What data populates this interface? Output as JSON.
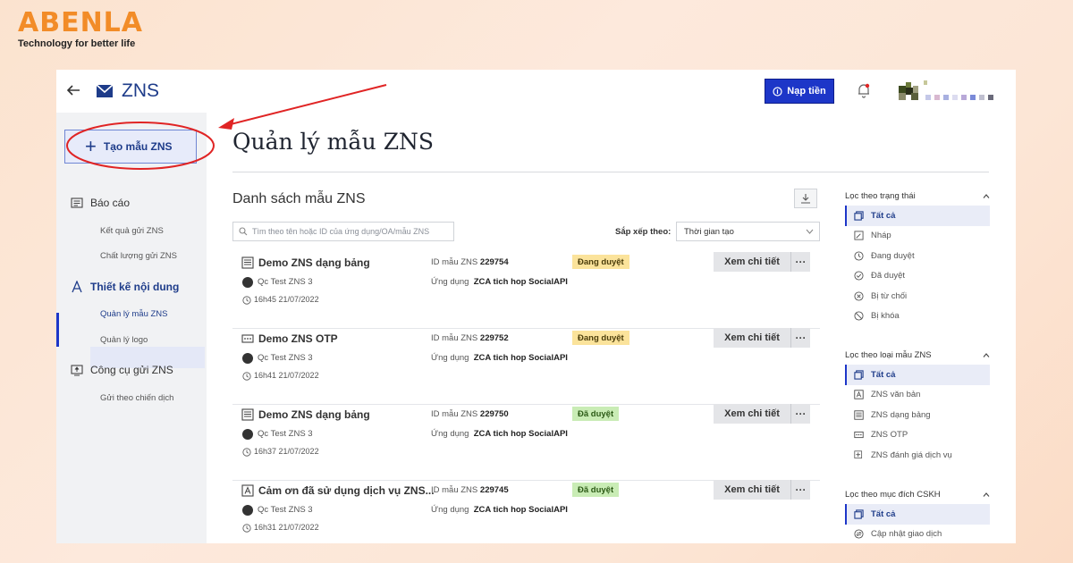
{
  "brand": {
    "title": "ABENLA",
    "tagline": "Technology for better life"
  },
  "topbar": {
    "app_title": "ZNS",
    "topup_label": "Nạp tiền"
  },
  "sidebar": {
    "create_label": "Tạo mẫu ZNS",
    "sections": [
      {
        "label": "Báo cáo",
        "items": [
          "Kết quả gửi ZNS",
          "Chất lượng gửi ZNS"
        ]
      },
      {
        "label": "Thiết kế nội dung",
        "items": [
          "Quản lý mẫu ZNS",
          "Quản lý logo"
        ]
      },
      {
        "label": "Công cụ gửi ZNS",
        "items": [
          "Gửi theo chiến dịch"
        ]
      }
    ]
  },
  "main": {
    "page_title": "Quản lý mẫu ZNS",
    "list_title": "Danh sách mẫu ZNS",
    "search_placeholder": "Tìm theo tên hoặc ID của ứng dụng/OA/mẫu ZNS",
    "sort_label": "Sắp xếp theo:",
    "sort_value": "Thời gian tạo",
    "id_label": "ID mẫu ZNS",
    "app_label": "Ứng dụng",
    "view_label": "Xem chi tiết",
    "more_label": "···",
    "templates": [
      {
        "name": "Demo ZNS dạng bảng",
        "icon": "table-template-icon",
        "creator": "Qc Test ZNS 3",
        "time": "16h45 21/07/2022",
        "id": "229754",
        "app": "ZCA tich hop SocialAPI",
        "status": "Đang duyệt",
        "status_kind": "pending"
      },
      {
        "name": "Demo ZNS OTP",
        "icon": "otp-template-icon",
        "creator": "Qc Test ZNS 3",
        "time": "16h41 21/07/2022",
        "id": "229752",
        "app": "ZCA tich hop SocialAPI",
        "status": "Đang duyệt",
        "status_kind": "pending"
      },
      {
        "name": "Demo ZNS dạng bảng",
        "icon": "table-template-icon",
        "creator": "Qc Test ZNS 3",
        "time": "16h37 21/07/2022",
        "id": "229750",
        "app": "ZCA tich hop SocialAPI",
        "status": "Đã duyệt",
        "status_kind": "approved"
      },
      {
        "name": "Cảm ơn đã sử dụng dịch vụ ZNS...",
        "icon": "text-template-icon",
        "creator": "Qc Test ZNS 3",
        "time": "16h31 21/07/2022",
        "id": "229745",
        "app": "ZCA tich hop SocialAPI",
        "status": "Đã duyệt",
        "status_kind": "approved"
      }
    ]
  },
  "filters": [
    {
      "title": "Lọc theo trạng thái",
      "options": [
        {
          "label": "Tất cả",
          "icon": "copy-icon",
          "active": true
        },
        {
          "label": "Nháp",
          "icon": "edit-icon"
        },
        {
          "label": "Đang duyệt",
          "icon": "clock-icon"
        },
        {
          "label": "Đã duyệt",
          "icon": "check-circle-icon"
        },
        {
          "label": "Bị từ chối",
          "icon": "x-circle-icon"
        },
        {
          "label": "Bị khóa",
          "icon": "ban-icon"
        }
      ]
    },
    {
      "title": "Lọc theo loại mẫu ZNS",
      "options": [
        {
          "label": "Tất cả",
          "icon": "copy-icon",
          "active": true
        },
        {
          "label": "ZNS văn bản",
          "icon": "text-template-icon"
        },
        {
          "label": "ZNS dạng bảng",
          "icon": "table-template-icon"
        },
        {
          "label": "ZNS OTP",
          "icon": "otp-template-icon"
        },
        {
          "label": "ZNS đánh giá dịch vụ",
          "icon": "rating-template-icon"
        }
      ]
    },
    {
      "title": "Lọc theo mục đích CSKH",
      "options": [
        {
          "label": "Tất cả",
          "icon": "copy-icon",
          "active": true
        },
        {
          "label": "Cập nhật giao dịch",
          "icon": "transaction-icon"
        }
      ]
    }
  ],
  "colors": {
    "brand_orange": "#f28c28",
    "primary_blue": "#1d36c8",
    "annotation_red": "#e02424",
    "pending_badge": "#fbe39b",
    "approved_badge": "#c9ecb5"
  }
}
